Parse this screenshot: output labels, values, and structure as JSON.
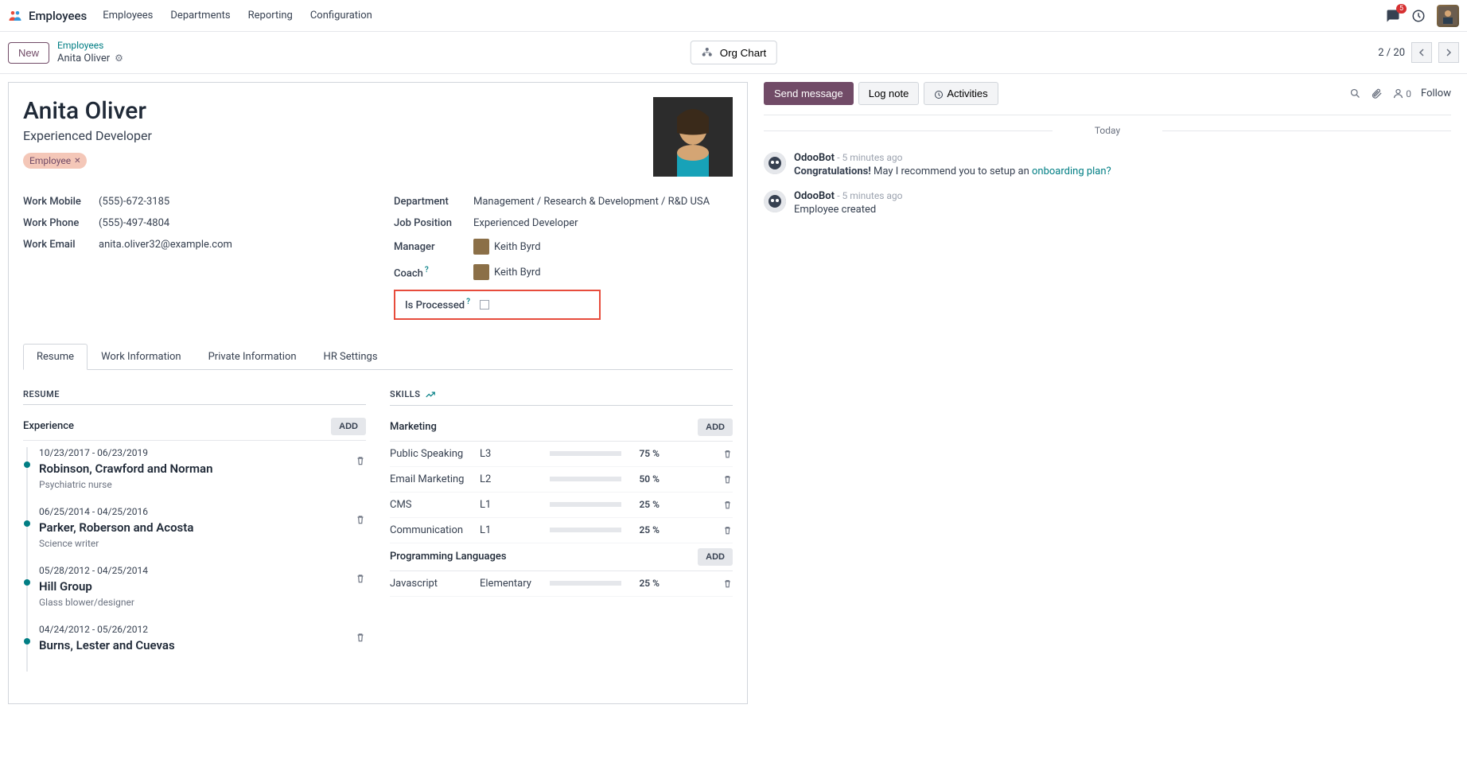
{
  "app": {
    "name": "Employees",
    "menu": [
      "Employees",
      "Departments",
      "Reporting",
      "Configuration"
    ],
    "notif_count": "5"
  },
  "breadcrumb": {
    "new_btn": "New",
    "parent": "Employees",
    "current": "Anita Oliver",
    "org_chart": "Org Chart",
    "pager": "2 / 20"
  },
  "employee": {
    "name": "Anita Oliver",
    "job_title": "Experienced Developer",
    "tag": "Employee",
    "work_mobile_label": "Work Mobile",
    "work_mobile": "(555)-672-3185",
    "work_phone_label": "Work Phone",
    "work_phone": "(555)-497-4804",
    "work_email_label": "Work Email",
    "work_email": "anita.oliver32@example.com",
    "department_label": "Department",
    "department": "Management / Research & Development / R&D USA",
    "job_position_label": "Job Position",
    "job_position": "Experienced Developer",
    "manager_label": "Manager",
    "manager": "Keith Byrd",
    "coach_label": "Coach",
    "coach": "Keith Byrd",
    "is_processed_label": "Is Processed"
  },
  "tabs": [
    "Resume",
    "Work Information",
    "Private Information",
    "HR Settings"
  ],
  "resume": {
    "section_title": "RESUME",
    "experience_title": "Experience",
    "add_label": "ADD",
    "items": [
      {
        "dates": "10/23/2017 - 06/23/2019",
        "title": "Robinson, Crawford and Norman",
        "desc": "Psychiatric nurse"
      },
      {
        "dates": "06/25/2014 - 04/25/2016",
        "title": "Parker, Roberson and Acosta",
        "desc": "Science writer"
      },
      {
        "dates": "05/28/2012 - 04/25/2014",
        "title": "Hill Group",
        "desc": "Glass blower/designer"
      },
      {
        "dates": "04/24/2012 - 05/26/2012",
        "title": "Burns, Lester and Cuevas",
        "desc": ""
      }
    ]
  },
  "skills": {
    "section_title": "SKILLS",
    "add_label": "ADD",
    "groups": [
      {
        "name": "Marketing",
        "items": [
          {
            "name": "Public Speaking",
            "level": "L3",
            "pct": "75 %",
            "pct_val": 75
          },
          {
            "name": "Email Marketing",
            "level": "L2",
            "pct": "50 %",
            "pct_val": 50
          },
          {
            "name": "CMS",
            "level": "L1",
            "pct": "25 %",
            "pct_val": 25
          },
          {
            "name": "Communication",
            "level": "L1",
            "pct": "25 %",
            "pct_val": 25
          }
        ]
      },
      {
        "name": "Programming Languages",
        "items": [
          {
            "name": "Javascript",
            "level": "Elementary",
            "pct": "25 %",
            "pct_val": 25
          }
        ]
      }
    ]
  },
  "chatter": {
    "send_message": "Send message",
    "log_note": "Log note",
    "activities": "Activities",
    "follow": "Follow",
    "follower_count": "0",
    "today": "Today",
    "messages": [
      {
        "author": "OdooBot",
        "time": "- 5 minutes ago",
        "text_bold": "Congratulations!",
        "text": " May I recommend you to setup an ",
        "link": "onboarding plan?"
      },
      {
        "author": "OdooBot",
        "time": "- 5 minutes ago",
        "text": "Employee created"
      }
    ]
  }
}
